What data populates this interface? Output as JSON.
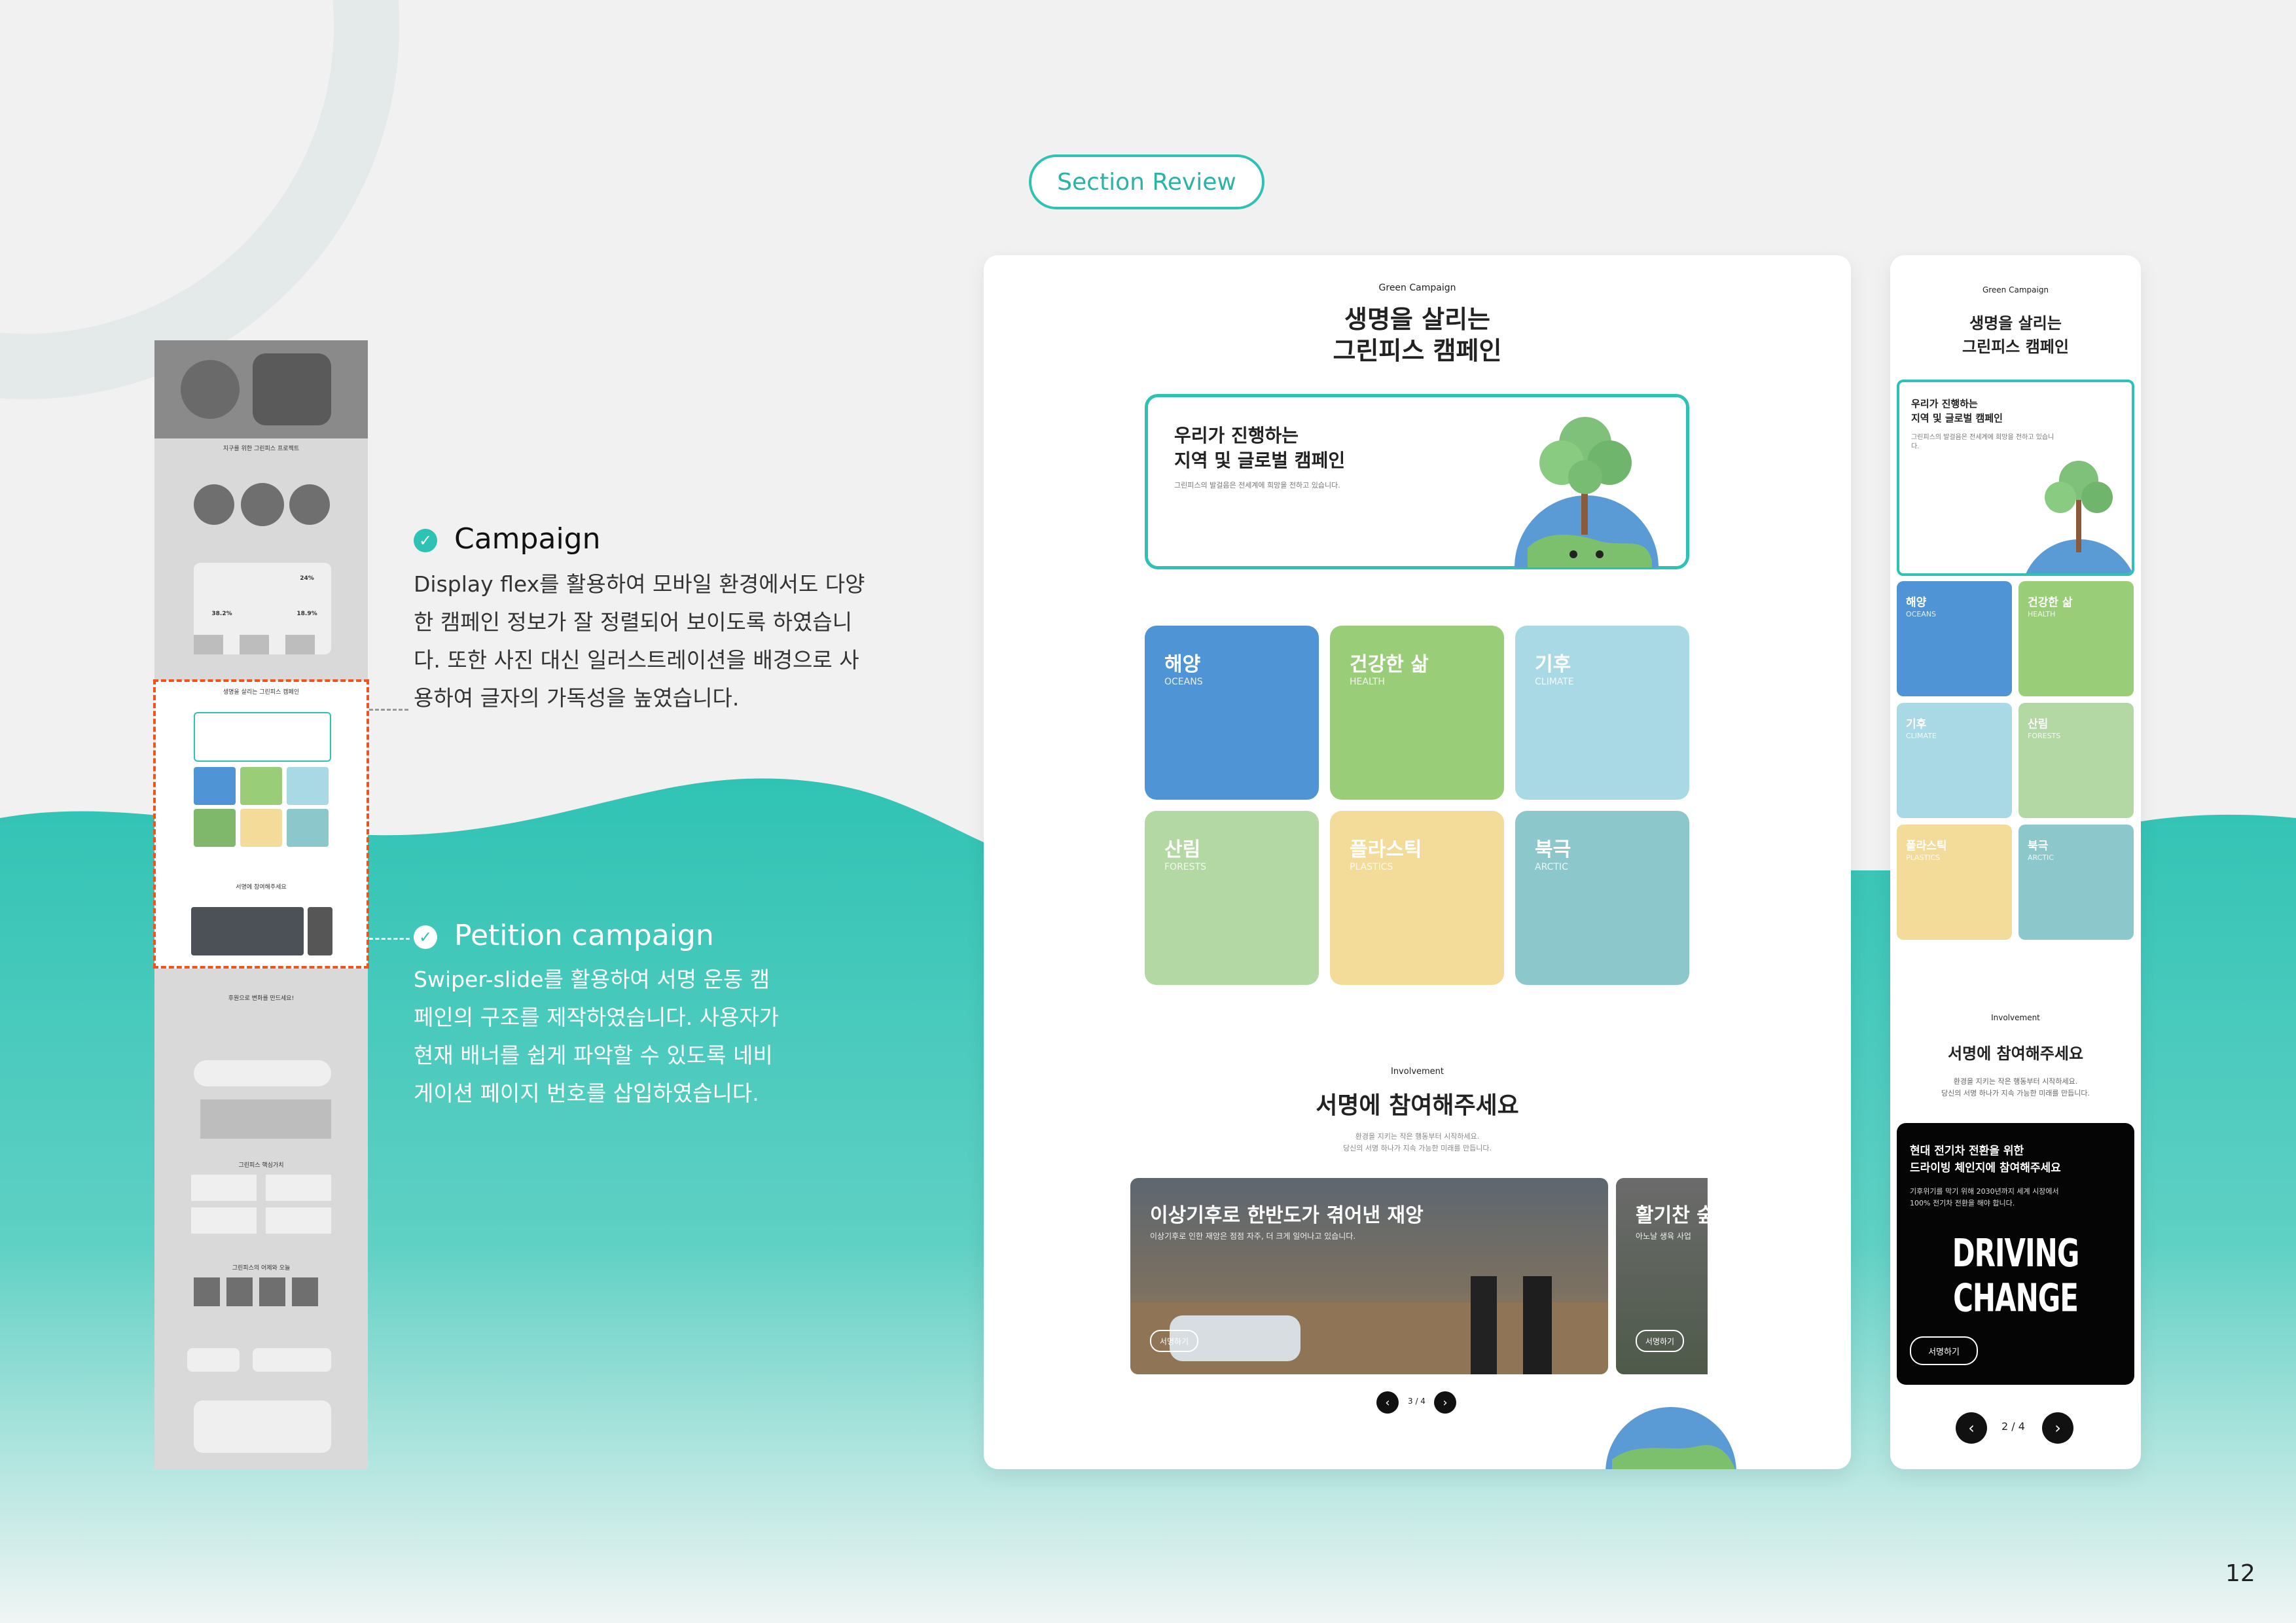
{
  "section_label": "Section Review",
  "page_number": "12",
  "descriptions": [
    {
      "title": "Campaign",
      "body_lines": [
        "Display flex를 활용하여 모바일 환경에서도 다양",
        "한 캠페인 정보가 잘 정렬되어 보이도록 하였습니",
        "다. 또한 사진 대신 일러스트레이션을 배경으로 사",
        "용하여 글자의 가독성을 높였습니다."
      ]
    },
    {
      "title": "Petition campaign",
      "body_lines": [
        "Swiper-slide를 활용하여 서명 운동 캠",
        "페인의 구조를 제작하였습니다. 사용자가",
        "현재 배너를 쉽게 파악할 수 있도록 네비",
        "게이션 페이지 번호를 삽입하였습니다."
      ]
    }
  ],
  "desktop": {
    "eyebrow": "Green Campaign",
    "title_line1": "생명을 살리는",
    "title_line2": "그린피스 캠페인",
    "feature": {
      "title_line1": "우리가 진행하는",
      "title_line2": "지역 및 글로벌 캠페인",
      "sub": "그린피스의 발걸음은 전세계에 희망을 전하고 있습니다."
    },
    "categories": [
      {
        "ko": "해양",
        "en": "OCEANS",
        "color": "#4f95d6"
      },
      {
        "ko": "건강한 삶",
        "en": "HEALTH",
        "color": "#9acd78"
      },
      {
        "ko": "기후",
        "en": "CLIMATE",
        "color": "#a9d9e5"
      },
      {
        "ko": "산림",
        "en": "FORESTS",
        "color": "#b4d8a3"
      },
      {
        "ko": "플라스틱",
        "en": "PLASTICS",
        "color": "#f3dc9a"
      },
      {
        "ko": "북극",
        "en": "ARCTIC",
        "color": "#8cc7cc"
      }
    ],
    "involvement_eyebrow": "Involvement",
    "involvement_title": "서명에 참여해주세요",
    "involvement_sub1": "환경을 지키는 작은 행동부터 시작하세요.",
    "involvement_sub2": "당신의 서명 하나가 지속 가능한 미래를 만듭니다.",
    "slide1_title": "이상기후로 한반도가 겪어낸 재앙",
    "slide1_sub": "이상기후로 인한 재앙은 점점 자주, 더 크게 일어나고 있습니다.",
    "slide1_button": "서명하기",
    "slide2_title": "활기찬 숲",
    "slide2_sub": "아노날 생육 사업",
    "slide2_button": "서명하기",
    "pager": "3 / 4"
  },
  "mobile": {
    "eyebrow": "Green Campaign",
    "title_line1": "생명을 살리는",
    "title_line2": "그린피스 캠페인",
    "feature_line1": "우리가 진행하는",
    "feature_line2": "지역 및 글로벌 캠페인",
    "feature_sub1": "그린피스의 발걸음은 전세계에 희망을 전하고 있습니",
    "feature_sub2": "다.",
    "involvement_eyebrow": "Involvement",
    "involvement_title": "서명에 참여해주세요",
    "involvement_sub1": "환경을 지키는 작은 행동부터 시작하세요.",
    "involvement_sub2": "당신의 서명 하나가 지속 가능한 미래를 만듭니다.",
    "banner_title1": "현대 전기차 전환을 위한",
    "banner_title2": "드라이빙 체인지에 참여해주세요",
    "banner_sub1": "기후위기를 막기 위해 2030년까지 세계 시장에서",
    "banner_sub2": "100% 전기차 전환을 해야 합니다.",
    "banner_logo": "DRIVING CHANGE",
    "banner_button": "서명하기",
    "pager": "2 / 4"
  },
  "thumbnail_texts": {
    "t1": "지구를 위한 그린피스 프로젝트",
    "t2": "생명을 살리는 그린피스 캠페인",
    "t3": "서명에 참여해주세요",
    "t4": "후원으로 변화를 만드세요!",
    "t5": "그린피스 핵심가치",
    "t6": "그린피스의 어제와 오늘",
    "p1": "38.2%",
    "p2": "24%",
    "p3": "18.9%"
  },
  "colors": {
    "accent": "#2ec2b4",
    "highlight": "#f0541e"
  }
}
